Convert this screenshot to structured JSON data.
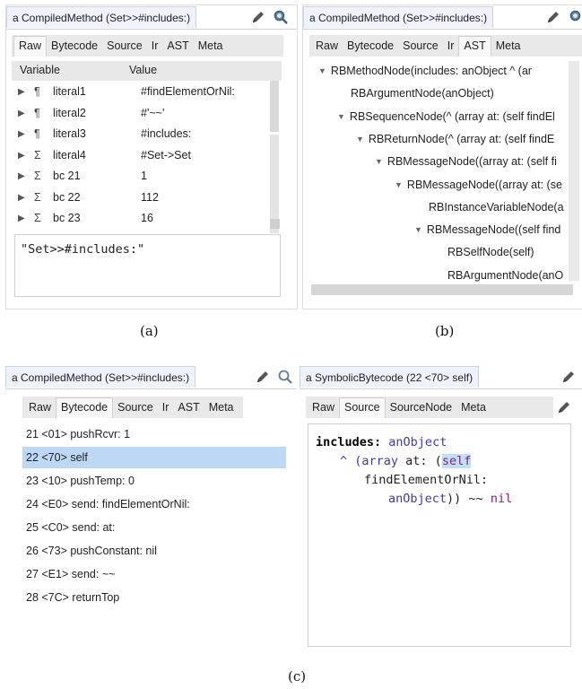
{
  "panel_a": {
    "title": "a CompiledMethod (Set>>#includes:)",
    "tabs": [
      "Raw",
      "Bytecode",
      "Source",
      "Ir",
      "AST",
      "Meta"
    ],
    "active_tab": "Raw",
    "columns": [
      "Variable",
      "Value"
    ],
    "rows": [
      {
        "marker": "¶",
        "variable": "literal1",
        "value": "#findElementOrNil:"
      },
      {
        "marker": "¶",
        "variable": "literal2",
        "value": "#'~~'"
      },
      {
        "marker": "¶",
        "variable": "literal3",
        "value": "#includes:"
      },
      {
        "marker": "Σ",
        "variable": "literal4",
        "value": "#Set->Set"
      },
      {
        "marker": "Σ",
        "variable": "bc 21",
        "value": "1"
      },
      {
        "marker": "Σ",
        "variable": "bc 22",
        "value": "112"
      },
      {
        "marker": "Σ",
        "variable": "bc 23",
        "value": "16"
      }
    ],
    "evaluator_text": "\"Set>>#includes:\"",
    "caption": "(a)"
  },
  "panel_b": {
    "title": "a CompiledMethod (Set>>#includes:)",
    "tabs": [
      "Raw",
      "Bytecode",
      "Source",
      "Ir",
      "AST",
      "Meta"
    ],
    "active_tab": "AST",
    "nodes": [
      {
        "expand": "▼",
        "label": "RBMethodNode(includes: anObject      ^ (ar"
      },
      {
        "expand": "",
        "label": "RBArgumentNode(anObject)"
      },
      {
        "expand": "▼",
        "label": "RBSequenceNode(^ (array at: (self findEl"
      },
      {
        "expand": "▼",
        "label": "RBReturnNode(^ (array at: (self findE"
      },
      {
        "expand": "▼",
        "label": "RBMessageNode((array at: (self fi"
      },
      {
        "expand": "▼",
        "label": "RBMessageNode((array at: (se"
      },
      {
        "expand": "",
        "label": "RBInstanceVariableNode(a"
      },
      {
        "expand": "▼",
        "label": "RBMessageNode((self find"
      },
      {
        "expand": "",
        "label": "RBSelfNode(self)"
      },
      {
        "expand": "",
        "label": "RBArgumentNode(anO"
      }
    ],
    "caption": "(b)"
  },
  "panel_c_left": {
    "title": "a CompiledMethod (Set>>#includes:)",
    "tabs": [
      "Raw",
      "Bytecode",
      "Source",
      "Ir",
      "AST",
      "Meta"
    ],
    "active_tab": "Bytecode",
    "bytecodes": [
      "21 <01> pushRcvr: 1",
      "22 <70> self",
      "23 <10> pushTemp: 0",
      "24 <E0> send: findElementOrNil:",
      "25 <C0> send: at:",
      "26 <73> pushConstant: nil",
      "27 <E1> send: ~~",
      "28 <7C> returnTop"
    ],
    "selected_index": 1
  },
  "panel_c_right": {
    "title": "a SymbolicBytecode (22 <70> self)",
    "tabs": [
      "Raw",
      "Source",
      "SourceNode",
      "Meta"
    ],
    "active_tab": "Source",
    "source": {
      "selector": "includes:",
      "argument": "anObject",
      "line2_pre": "^ (",
      "line2_array": "array",
      "line2_mid": " at: (",
      "line2_self": "self",
      "line3": "findElementOrNil:",
      "line4_arg": "anObject",
      "line4_mid": ")) ~~ ",
      "line4_nil": "nil"
    }
  },
  "caption_c": "(c)",
  "colors": {
    "selection": "#bcd8f5",
    "title_tab_bg": "#eef3fb",
    "tab_strip_bg": "#e9e9e9",
    "code_keyword": "#000000",
    "code_variable": "#3b3bb5",
    "code_pseudo_var": "#8b1a8b"
  }
}
